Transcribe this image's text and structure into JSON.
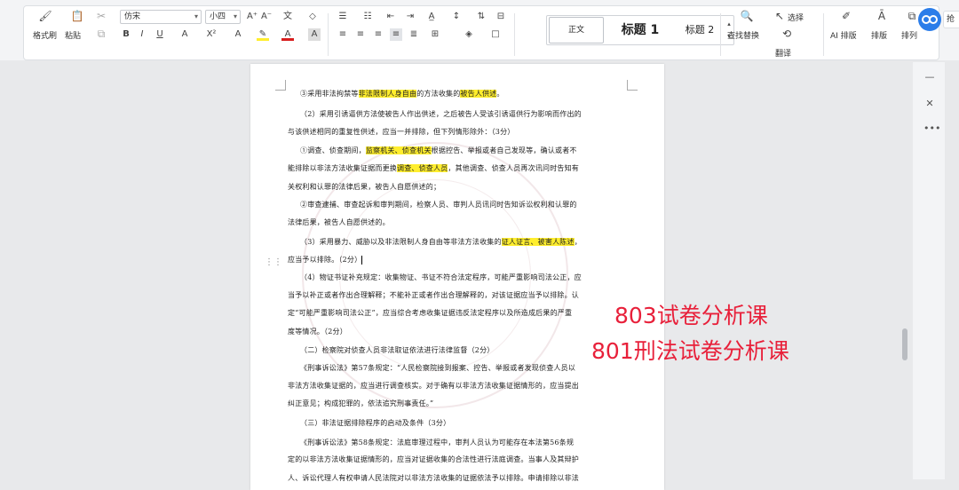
{
  "ribbon": {
    "format_painter": "格式刷",
    "paste": "粘贴",
    "font_family": "仿宋",
    "font_size": "小四",
    "styles": {
      "normal": "正文",
      "heading1": "标题 1",
      "heading2": "标题 2"
    },
    "find_replace": "查找替换",
    "select": "选择",
    "translate": "翻译",
    "ai_layout": "AI 排版",
    "layout": "排版",
    "arrange": "排列"
  },
  "document": {
    "lines": [
      {
        "t": "③采用非法拘禁等|非法限制人身自由|的方法收集的|被告人供述|。"
      },
      {
        "t": "（2）采用引诱逼供方法使被告人作出供述，之后被告人受该引诱逼供行为影响而作出的"
      },
      {
        "t": "与该供述相同的重复性供述，应当一并排除，但下列情形除外：（3分）"
      },
      {
        "t": "①调查、侦查期间，|监察机关、侦查机关|根据控告、举报或者自己发现等，确认或者不"
      },
      {
        "t": "能排除以非法方法收集证据而更换|调查、侦查人员|，其他调查、侦查人员再次讯问时告知有"
      },
      {
        "t": "关权利和认罪的法律后果，被告人自愿供述的；"
      },
      {
        "t": "②审查逮捕、审查起诉和审判期间，检察人员、审判人员讯问时告知诉讼权利和认罪的"
      },
      {
        "t": "法律后果，被告人自愿供述的。"
      },
      {
        "t": "（3）采用暴力、威胁以及非法限制人身自由等非法方法收集的|证人证言、被害人陈述|，"
      },
      {
        "t": "应当予以排除。（2分）"
      },
      {
        "t": "（4）物证书证补充规定：收集物证、书证不符合法定程序，可能严重影响司法公正，应"
      },
      {
        "t": "当予以补正或者作出合理解释；不能补正或者作出合理解释的，对该证据应当予以排除。认"
      },
      {
        "t": "定“可能严重影响司法公正”，应当综合考虑收集证据违反法定程序以及所造成后果的严重"
      },
      {
        "t": "度等情况。（2分）"
      },
      {
        "t": "（二）检察院对侦查人员非法取证依法进行法律监督（2分）"
      },
      {
        "t": "《刑事诉讼法》第57条规定：“人民检察院接到报案、控告、举报或者发现侦查人员以"
      },
      {
        "t": "非法方法收集证据的，应当进行调查核实。对于确有以非法方法收集证据情形的，应当提出"
      },
      {
        "t": "纠正意见；构成犯罪的，依法追究刑事责任。”"
      },
      {
        "t": "（三）非法证据排除程序的启动及条件（3分）"
      },
      {
        "t": "《刑事诉讼法》第58条规定：法庭审理过程中，审判人员认为可能存在本法第56条规"
      },
      {
        "t": "定的以非法方法收集证据情形的，应当对证据收集的合法性进行法庭调查。当事人及其辩护"
      },
      {
        "t": "人、诉讼代理人有权申请人民法院对以非法方法收集的证据依法予以排除。申请排除以非法"
      }
    ]
  },
  "overlay": {
    "line1": "803试卷分析课",
    "line2": "801刑法试卷分析课"
  },
  "colors": {
    "highlight": "#ffee2e",
    "overlay_text": "#e8203a",
    "accent": "#2b7de9"
  },
  "icons": [
    "format-painter-icon",
    "paste-icon",
    "cut-icon",
    "copy-icon",
    "bold-icon",
    "italic-icon",
    "underline-icon",
    "search-icon",
    "select-icon",
    "cloud-icon"
  ]
}
